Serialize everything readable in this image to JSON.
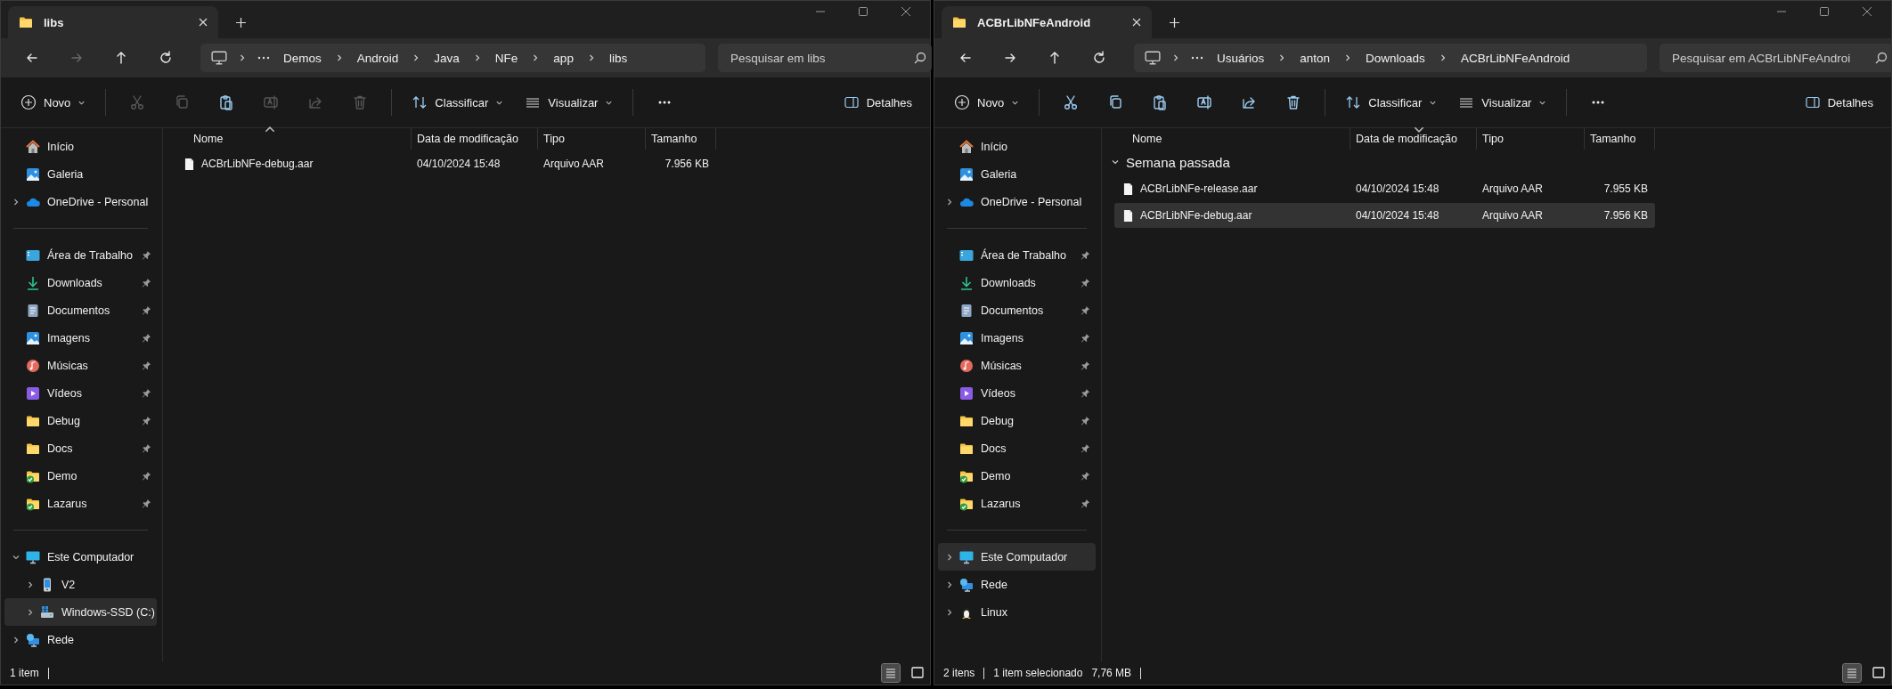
{
  "windows": [
    {
      "tab": {
        "title": "libs"
      },
      "nav_buttons": [
        {
          "kind": "back",
          "disabled": false
        },
        {
          "kind": "forward",
          "disabled": true
        },
        {
          "kind": "up",
          "disabled": false
        },
        {
          "kind": "refresh",
          "disabled": false
        }
      ],
      "breadcrumb": [
        "Demos",
        "Android",
        "Java",
        "NFe",
        "app",
        "libs"
      ],
      "search": {
        "placeholder": "Pesquisar em libs"
      },
      "toolbar": {
        "new_label": "Novo",
        "actions": [
          {
            "kind": "cut",
            "disabled": true
          },
          {
            "kind": "copy",
            "disabled": true
          },
          {
            "kind": "paste",
            "disabled": false
          },
          {
            "kind": "rename",
            "disabled": true
          },
          {
            "kind": "share",
            "disabled": true
          },
          {
            "kind": "delete",
            "disabled": true
          }
        ],
        "sort_label": "Classificar",
        "view_label": "Visualizar",
        "details_label": "Detalhes"
      },
      "sidebar": {
        "sections": [
          {
            "items": [
              {
                "label": "Início",
                "kind": "home",
                "selected": false
              },
              {
                "label": "Galeria",
                "kind": "gallery",
                "selected": false
              },
              {
                "label": "OneDrive - Personal",
                "kind": "cloud",
                "selected": false,
                "expanded": false
              }
            ]
          },
          {
            "items": [
              {
                "label": "Área de Trabalho",
                "kind": "desktop",
                "selected": false,
                "pinned": true
              },
              {
                "label": "Downloads",
                "kind": "download",
                "selected": false,
                "pinned": true
              },
              {
                "label": "Documentos",
                "kind": "documents",
                "selected": false,
                "pinned": true
              },
              {
                "label": "Imagens",
                "kind": "pictures",
                "selected": false,
                "pinned": true
              },
              {
                "label": "Músicas",
                "kind": "music",
                "selected": false,
                "pinned": true
              },
              {
                "label": "Vídeos",
                "kind": "videos",
                "selected": false,
                "pinned": true
              },
              {
                "label": "Debug",
                "kind": "folder",
                "selected": false,
                "pinned": true
              },
              {
                "label": "Docs",
                "kind": "folder",
                "selected": false,
                "pinned": true
              },
              {
                "label": "Demo",
                "kind": "folder-check",
                "selected": false,
                "pinned": true
              },
              {
                "label": "Lazarus",
                "kind": "folder-check",
                "selected": false,
                "pinned": true
              }
            ]
          },
          {
            "items": [
              {
                "label": "Este Computador",
                "kind": "computer",
                "selected": false,
                "expanded": true,
                "children": [
                  {
                    "label": "V2",
                    "kind": "phone",
                    "selected": false,
                    "expanded": false
                  },
                  {
                    "label": "Windows-SSD (C:)",
                    "kind": "drive",
                    "selected": true,
                    "expanded": false
                  }
                ]
              },
              {
                "label": "Rede",
                "kind": "network",
                "selected": false,
                "expanded": false
              }
            ]
          }
        ]
      },
      "columns": [
        {
          "label": "Nome",
          "sorted": true,
          "descending": false
        },
        {
          "label": "Data de modificação",
          "sorted": false
        },
        {
          "label": "Tipo",
          "sorted": false
        },
        {
          "label": "Tamanho",
          "sorted": false
        }
      ],
      "groups": [
        {
          "files": [
            {
              "name": "ACBrLibNFe-debug.aar",
              "modified": "04/10/2024 15:48",
              "type": "Arquivo AAR",
              "size": "7.956 KB",
              "selected": false
            }
          ]
        }
      ],
      "status": [
        {
          "texts": [
            "1 item"
          ]
        }
      ],
      "view_buttons": [
        {
          "kind": "details",
          "selected": true
        },
        {
          "kind": "tiles",
          "selected": false
        }
      ]
    },
    {
      "tab": {
        "title": "ACBrLibNFeAndroid"
      },
      "nav_buttons": [
        {
          "kind": "back",
          "disabled": false
        },
        {
          "kind": "forward",
          "disabled": false
        },
        {
          "kind": "up",
          "disabled": false
        },
        {
          "kind": "refresh",
          "disabled": false
        }
      ],
      "breadcrumb": [
        "Usuários",
        "anton",
        "Downloads",
        "ACBrLibNFeAndroid"
      ],
      "search": {
        "placeholder": "Pesquisar em ACBrLibNFeAndroi"
      },
      "toolbar": {
        "new_label": "Novo",
        "actions": [
          {
            "kind": "cut",
            "disabled": false
          },
          {
            "kind": "copy",
            "disabled": false
          },
          {
            "kind": "paste",
            "disabled": false
          },
          {
            "kind": "rename",
            "disabled": false
          },
          {
            "kind": "share",
            "disabled": false
          },
          {
            "kind": "delete",
            "disabled": false
          }
        ],
        "sort_label": "Classificar",
        "view_label": "Visualizar",
        "details_label": "Detalhes"
      },
      "sidebar": {
        "sections": [
          {
            "items": [
              {
                "label": "Início",
                "kind": "home",
                "selected": false
              },
              {
                "label": "Galeria",
                "kind": "gallery",
                "selected": false
              },
              {
                "label": "OneDrive - Personal",
                "kind": "cloud",
                "selected": false,
                "expanded": false
              }
            ]
          },
          {
            "items": [
              {
                "label": "Área de Trabalho",
                "kind": "desktop",
                "selected": false,
                "pinned": true
              },
              {
                "label": "Downloads",
                "kind": "download",
                "selected": false,
                "pinned": true
              },
              {
                "label": "Documentos",
                "kind": "documents",
                "selected": false,
                "pinned": true
              },
              {
                "label": "Imagens",
                "kind": "pictures",
                "selected": false,
                "pinned": true
              },
              {
                "label": "Músicas",
                "kind": "music",
                "selected": false,
                "pinned": true
              },
              {
                "label": "Vídeos",
                "kind": "videos",
                "selected": false,
                "pinned": true
              },
              {
                "label": "Debug",
                "kind": "folder",
                "selected": false,
                "pinned": true
              },
              {
                "label": "Docs",
                "kind": "folder",
                "selected": false,
                "pinned": true
              },
              {
                "label": "Demo",
                "kind": "folder-check",
                "selected": false,
                "pinned": true
              },
              {
                "label": "Lazarus",
                "kind": "folder-check",
                "selected": false,
                "pinned": true
              }
            ]
          },
          {
            "items": [
              {
                "label": "Este Computador",
                "kind": "computer",
                "selected": true,
                "expanded": false
              },
              {
                "label": "Rede",
                "kind": "network",
                "selected": false,
                "expanded": false
              },
              {
                "label": "Linux",
                "kind": "linux",
                "selected": false,
                "expanded": false
              }
            ]
          }
        ]
      },
      "columns": [
        {
          "label": "Nome",
          "sorted": false
        },
        {
          "label": "Data de modificação",
          "sorted": true,
          "descending": true
        },
        {
          "label": "Tipo",
          "sorted": false
        },
        {
          "label": "Tamanho",
          "sorted": false
        }
      ],
      "groups": [
        {
          "label": "Semana passada",
          "expanded": true,
          "files": [
            {
              "name": "ACBrLibNFe-release.aar",
              "modified": "04/10/2024 15:48",
              "type": "Arquivo AAR",
              "size": "7.955 KB",
              "selected": false
            },
            {
              "name": "ACBrLibNFe-debug.aar",
              "modified": "04/10/2024 15:48",
              "type": "Arquivo AAR",
              "size": "7.956 KB",
              "selected": true
            }
          ]
        }
      ],
      "status": [
        {
          "texts": [
            "2 itens"
          ]
        },
        {
          "texts": [
            "1 item selecionado",
            "7,76 MB"
          ]
        }
      ],
      "view_buttons": [
        {
          "kind": "details",
          "selected": true
        },
        {
          "kind": "tiles",
          "selected": false
        }
      ]
    }
  ]
}
